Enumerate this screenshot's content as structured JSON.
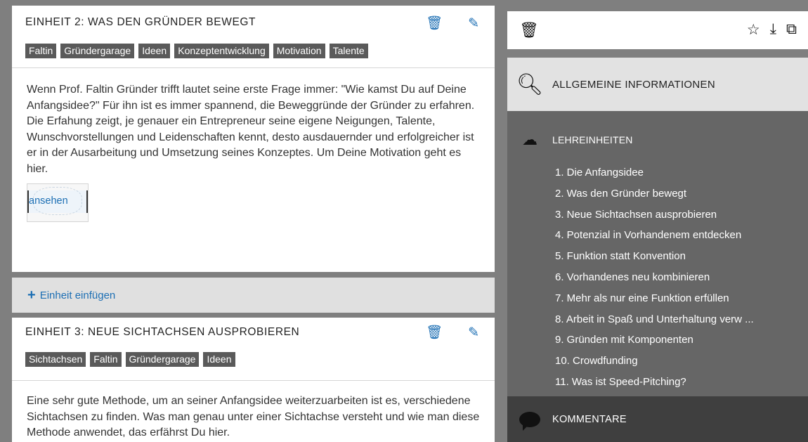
{
  "units": [
    {
      "title": "EINHEIT 2: WAS DEN GRÜNDER BEWEGT",
      "tags": [
        "Faltin",
        "Gründergarage",
        "Ideen",
        "Konzeptentwicklung",
        "Motivation",
        "Talente"
      ],
      "body": "Wenn Prof. Faltin Gründer trifft lautet seine erste Frage immer: \"Wie kamst Du auf Deine Anfangsidee?\" Für ihn ist es immer spannend, die Beweggründe der Gründer zu erfahren. Die Erfahung zeigt, je genauer ein Entrepreneur seine eigene Neigungen, Talente, Wunschvorstellungen und Leidenschaften kennt, desto ausdauernder und erfolgreicher ist er in der Ausarbeitung und Umsetzung seines Konzeptes. Um Deine Motivation geht es hier.",
      "thumb_label": "ansehen"
    },
    {
      "title": "EINHEIT 3: NEUE SICHTACHSEN AUSPROBIEREN",
      "tags": [
        "Sichtachsen",
        "Faltin",
        "Gründergarage",
        "Ideen"
      ],
      "body": "Eine sehr gute Methode, um an seiner Anfangsidee weiterzuarbeiten ist es, verschiedene Sichtachsen zu finden. Was man genau unter einer Sichtachse versteht und wie man diese Methode anwendet, das erfährst Du hier."
    }
  ],
  "insert_label": "Einheit einfügen",
  "sidebar": {
    "info_label": "ALLGEMEINE INFORMATIONEN",
    "lessons_label": "LEHREINHEITEN",
    "lessons": [
      "1. Die Anfangsidee",
      "2. Was den Gründer bewegt",
      "3. Neue Sichtachsen ausprobieren",
      "4. Potenzial in Vorhandenem entdecken",
      "5. Funktion statt Konvention",
      "6. Vorhandenes neu kombinieren",
      "7. Mehr als nur eine Funktion erfüllen",
      "8. Arbeit in Spaß und Unterhaltung verw ...",
      "9. Gründen mit Komponenten",
      "10. Crowdfunding",
      "11. Was ist Speed-Pitching?"
    ],
    "comments_label": "KOMMENTARE"
  },
  "icons": {
    "trash": "trash-icon",
    "edit": "pencil-icon",
    "star": "star-icon",
    "download": "download-icon",
    "copy": "copy-icon",
    "search": "search-icon",
    "cloud": "cloud-upload-icon",
    "chat": "chat-bubble-icon"
  },
  "colors": {
    "accent": "#1d6fb4",
    "tag_bg": "#5a5a5a",
    "lessons_bg": "#666666",
    "comments_bg": "#3f3f3f"
  }
}
